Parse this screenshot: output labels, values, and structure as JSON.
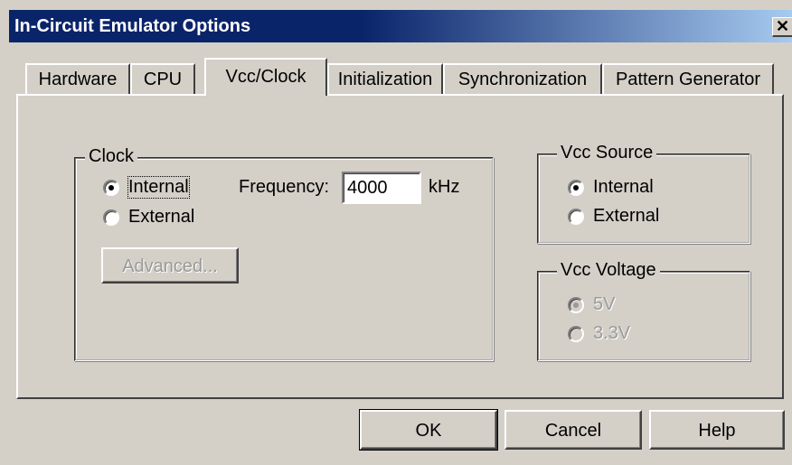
{
  "window": {
    "title": "In-Circuit Emulator Options",
    "close_glyph": "✕"
  },
  "tabs": [
    {
      "label": "Hardware"
    },
    {
      "label": "CPU"
    },
    {
      "label": "Vcc/Clock",
      "active": true
    },
    {
      "label": "Initialization"
    },
    {
      "label": "Synchronization"
    },
    {
      "label": "Pattern Generator"
    }
  ],
  "clock": {
    "group_label": "Clock",
    "options": [
      {
        "label": "Internal",
        "selected": true
      },
      {
        "label": "External",
        "selected": false
      }
    ],
    "frequency_label": "Frequency:",
    "frequency_value": "4000",
    "frequency_unit": "kHz",
    "advanced_label": "Advanced..."
  },
  "vcc_source": {
    "group_label": "Vcc Source",
    "options": [
      {
        "label": "Internal",
        "selected": true
      },
      {
        "label": "External",
        "selected": false
      }
    ]
  },
  "vcc_voltage": {
    "group_label": "Vcc Voltage",
    "options": [
      {
        "label": "5V",
        "selected": true
      },
      {
        "label": "3.3V",
        "selected": false
      }
    ]
  },
  "buttons": {
    "ok": "OK",
    "cancel": "Cancel",
    "help": "Help"
  },
  "colors": {
    "titlebar_start": "#0a246a",
    "titlebar_end": "#a6caf0",
    "face": "#d4d0c8",
    "disabled_text": "#9a9a9a"
  }
}
